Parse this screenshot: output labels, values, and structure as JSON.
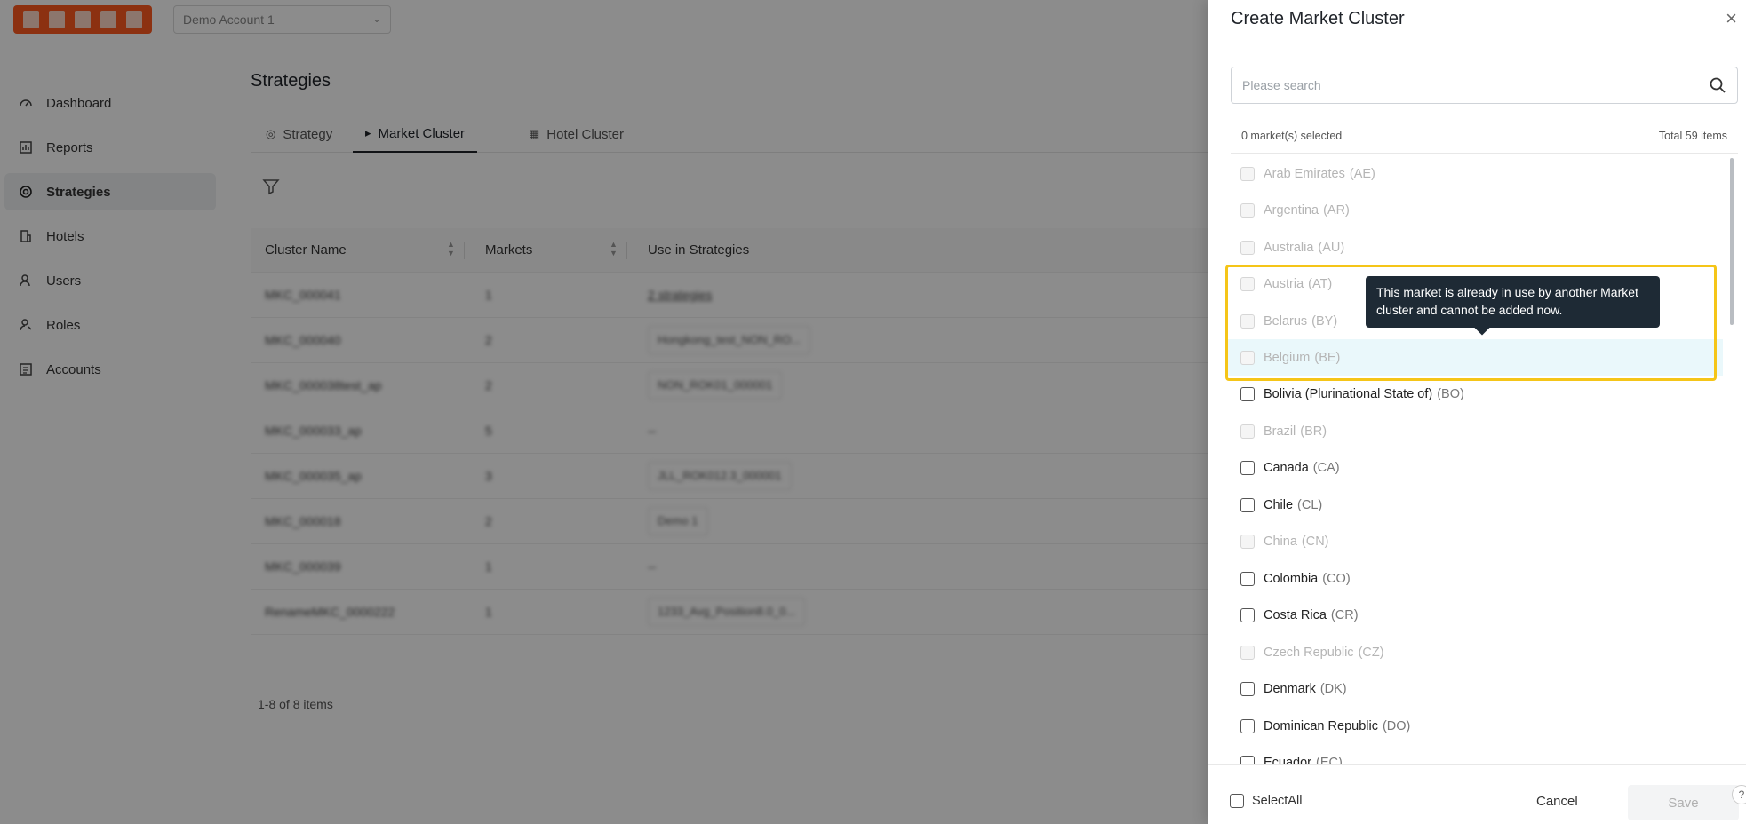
{
  "app": {
    "account_select": "Demo Account 1",
    "sidebar": [
      {
        "label": "Dashboard",
        "icon": "dashboard-icon"
      },
      {
        "label": "Reports",
        "icon": "report-icon"
      },
      {
        "label": "Strategies",
        "icon": "target-icon"
      },
      {
        "label": "Hotels",
        "icon": "building-icon"
      },
      {
        "label": "Users",
        "icon": "user-icon"
      },
      {
        "label": "Roles",
        "icon": "role-icon"
      },
      {
        "label": "Accounts",
        "icon": "accounts-icon"
      }
    ],
    "page_title": "Strategies",
    "tabs": [
      "Strategy",
      "Market Cluster",
      "Hotel Cluster"
    ],
    "active_tab": "Market Cluster",
    "table": {
      "headers": [
        "Cluster Name",
        "Markets",
        "Use in Strategies"
      ],
      "rows": [
        {
          "name": "MKC_000041",
          "markets": "1",
          "strategies": "2 strategies"
        },
        {
          "name": "MKC_000040",
          "markets": "2",
          "strategies": "Hongkong_test_NON_RO..."
        },
        {
          "name": "MKC_000038test_ap",
          "markets": "2",
          "strategies": "NON_ROK01_000001"
        },
        {
          "name": "MKC_000033_ap",
          "markets": "5",
          "strategies": "--"
        },
        {
          "name": "MKC_000035_ap",
          "markets": "3",
          "strategies": "JLL_ROK012.3_000001"
        },
        {
          "name": "MKC_000018",
          "markets": "2",
          "strategies": "Demo 1"
        },
        {
          "name": "MKC_000039",
          "markets": "1",
          "strategies": "--"
        },
        {
          "name": "RenameMKC_0000222",
          "markets": "1",
          "strategies": "1233_Avg_Position8.0_0..."
        }
      ],
      "pagination": "1-8 of 8 items"
    }
  },
  "drawer": {
    "title": "Create Market Cluster",
    "search_placeholder": "Please search",
    "selected_count": "0 market(s) selected",
    "total": "Total 59 items",
    "markets": [
      {
        "name": "Arab Emirates",
        "code": "(AE)",
        "disabled": true
      },
      {
        "name": "Argentina",
        "code": "(AR)",
        "disabled": true
      },
      {
        "name": "Australia",
        "code": "(AU)",
        "disabled": true
      },
      {
        "name": "Austria",
        "code": "(AT)",
        "disabled": true
      },
      {
        "name": "Belarus",
        "code": "(BY)",
        "disabled": true
      },
      {
        "name": "Belgium",
        "code": "(BE)",
        "disabled": true
      },
      {
        "name": "Bolivia (Plurinational State of)",
        "code": "(BO)",
        "disabled": false
      },
      {
        "name": "Brazil",
        "code": "(BR)",
        "disabled": true
      },
      {
        "name": "Canada",
        "code": "(CA)",
        "disabled": false
      },
      {
        "name": "Chile",
        "code": "(CL)",
        "disabled": false
      },
      {
        "name": "China",
        "code": "(CN)",
        "disabled": true
      },
      {
        "name": "Colombia",
        "code": "(CO)",
        "disabled": false
      },
      {
        "name": "Costa Rica",
        "code": "(CR)",
        "disabled": false
      },
      {
        "name": "Czech Republic",
        "code": "(CZ)",
        "disabled": true
      },
      {
        "name": "Denmark",
        "code": "(DK)",
        "disabled": false
      },
      {
        "name": "Dominican Republic",
        "code": "(DO)",
        "disabled": false
      },
      {
        "name": "Ecuador",
        "code": "(EC)",
        "disabled": false
      }
    ],
    "tooltip": "This market is already in use by another Market cluster and cannot be added now.",
    "select_all": "SelectAll",
    "cancel": "Cancel",
    "save": "Save"
  },
  "colors": {
    "highlight_box": "#f5c518",
    "tooltip_bg": "#1e2a35",
    "hover_row": "#eaf8fb",
    "logo": "#ff5a1f"
  }
}
